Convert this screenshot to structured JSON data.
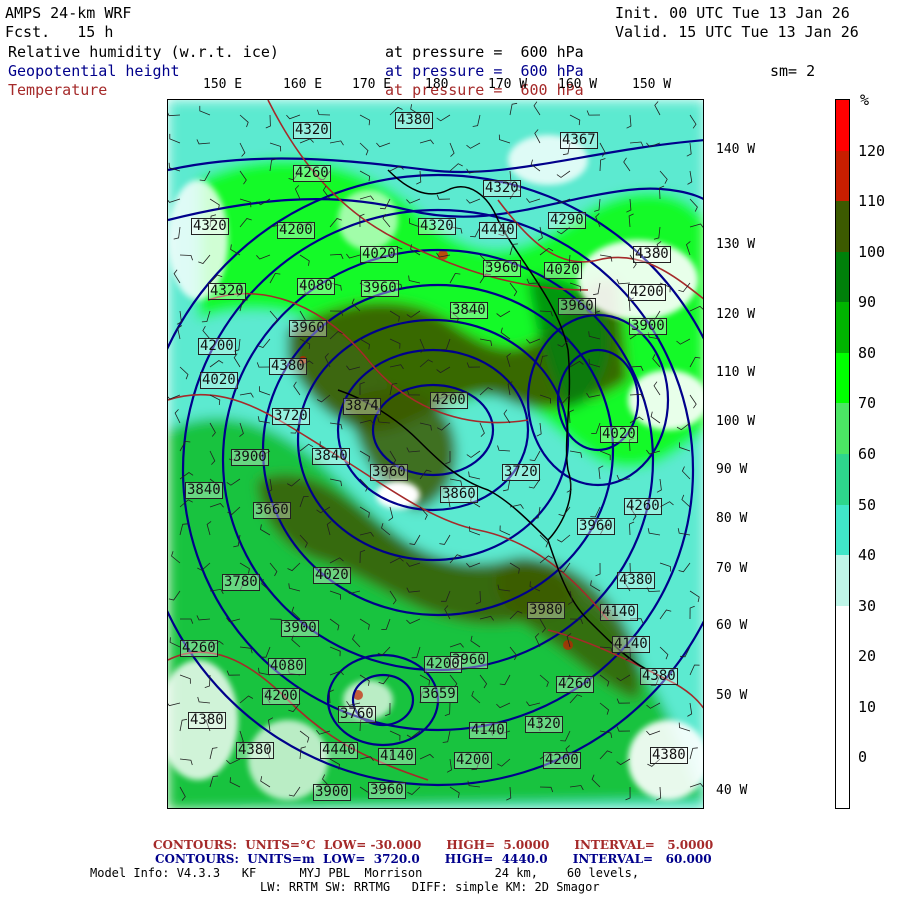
{
  "header": {
    "model": "AMPS 24-km WRF",
    "fcst": "Fcst.   15 h",
    "init": "Init. 00 UTC Tue 13 Jan 26",
    "valid": "Valid. 15 UTC Tue 13 Jan 26"
  },
  "fields": [
    {
      "name": "Relative humidity (w.r.t. ice)",
      "level": "at pressure =  600 hPa",
      "color": "#000000"
    },
    {
      "name": "Geopotential height",
      "level": "at pressure =  600 hPa",
      "color": "#00008b"
    },
    {
      "name": "Temperature",
      "level": "at pressure =  600 hPa",
      "color": "#a52a2a"
    }
  ],
  "smoothing": "sm= 2",
  "longitude_labels_top": [
    "150 E",
    "160 E",
    "170 E",
    "180",
    "170 W",
    "160 W",
    "150 W"
  ],
  "longitude_labels_right": [
    "140 W",
    "130 W",
    "120 W",
    "110 W",
    "100 W",
    "90 W",
    "80 W",
    "70 W",
    "60 W",
    "50 W",
    "40 W"
  ],
  "colorbar": {
    "unit": "%",
    "labels": [
      "120",
      "110",
      "100",
      "90",
      "80",
      "70",
      "60",
      "50",
      "40",
      "30",
      "20",
      "10",
      "0"
    ],
    "colors": [
      "#ff0000",
      "#c81e00",
      "#3c5a00",
      "#00800a",
      "#00b400",
      "#00ff00",
      "#4be664",
      "#2ed68c",
      "#40e6c8",
      "#bff5e8",
      "#ffffff",
      "#ffffff",
      "#ffffff",
      "#ffffff"
    ]
  },
  "height_contour_labels": [
    "4380",
    "4320",
    "4367",
    "4260",
    "4320",
    "4320",
    "4200",
    "4320",
    "4440",
    "4290",
    "4020",
    "4380",
    "3960",
    "4020",
    "3960",
    "4200",
    "4080",
    "4320",
    "3840",
    "3960",
    "3960",
    "3900",
    "4200",
    "4380",
    "3874",
    "4200",
    "4020",
    "4020",
    "3720",
    "3840",
    "3960",
    "3900",
    "3720",
    "3860",
    "3840",
    "3660",
    "3960",
    "4260",
    "3780",
    "4020",
    "4380",
    "3980",
    "4140",
    "3900",
    "4260",
    "4140",
    "3960",
    "4080",
    "4200",
    "4260",
    "4380",
    "3659",
    "3760",
    "4200",
    "4140",
    "4320",
    "4380",
    "4380",
    "4200",
    "4140",
    "4440",
    "4380",
    "4200",
    "3900",
    "3960"
  ],
  "footer": {
    "temp_contours": "CONTOURS:  UNITS=°C  LOW= -30.000      HIGH=  5.0000      INTERVAL=   5.0000",
    "height_contours": "CONTOURS:  UNITS=m  LOW=  3720.0      HIGH=  4440.0      INTERVAL=   60.000",
    "model_info": "Model Info: V4.3.3   KF      MYJ PBL  Morrison          24 km,    60 levels,",
    "physics": "LW: RRTM SW: RRTMG   DIFF: simple KM: 2D Smagor"
  }
}
